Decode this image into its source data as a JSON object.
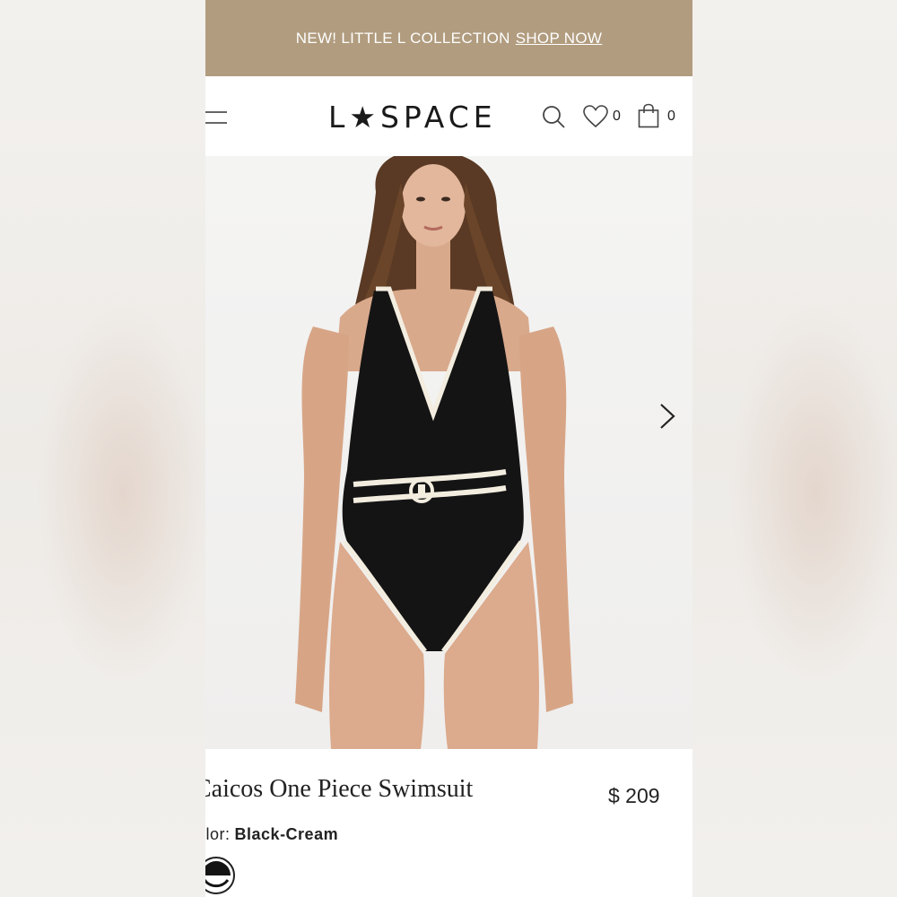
{
  "promo_bar": {
    "text": "NEW! LITTLE L COLLECTION",
    "link": "SHOP NOW"
  },
  "header": {
    "logo": "L★SPACE",
    "wishlist_count": "0",
    "cart_count": "0",
    "icons": [
      "menu-icon",
      "search-icon",
      "heart-icon",
      "shopping-bag-icon"
    ]
  },
  "product": {
    "image": "model-wearing-black-one-piece-swimsuit-with-cream-trim-and-belt",
    "title": "Caicos One Piece Swimsuit",
    "price": "$ 209",
    "color_label": "olor:",
    "color_value": "Black-Cream",
    "swatch": "black-cream-swatch"
  },
  "colors": {
    "promo_bg": "#b19c7f",
    "text": "#222222",
    "swimsuit": "#111111",
    "trim": "#f3ede0"
  }
}
